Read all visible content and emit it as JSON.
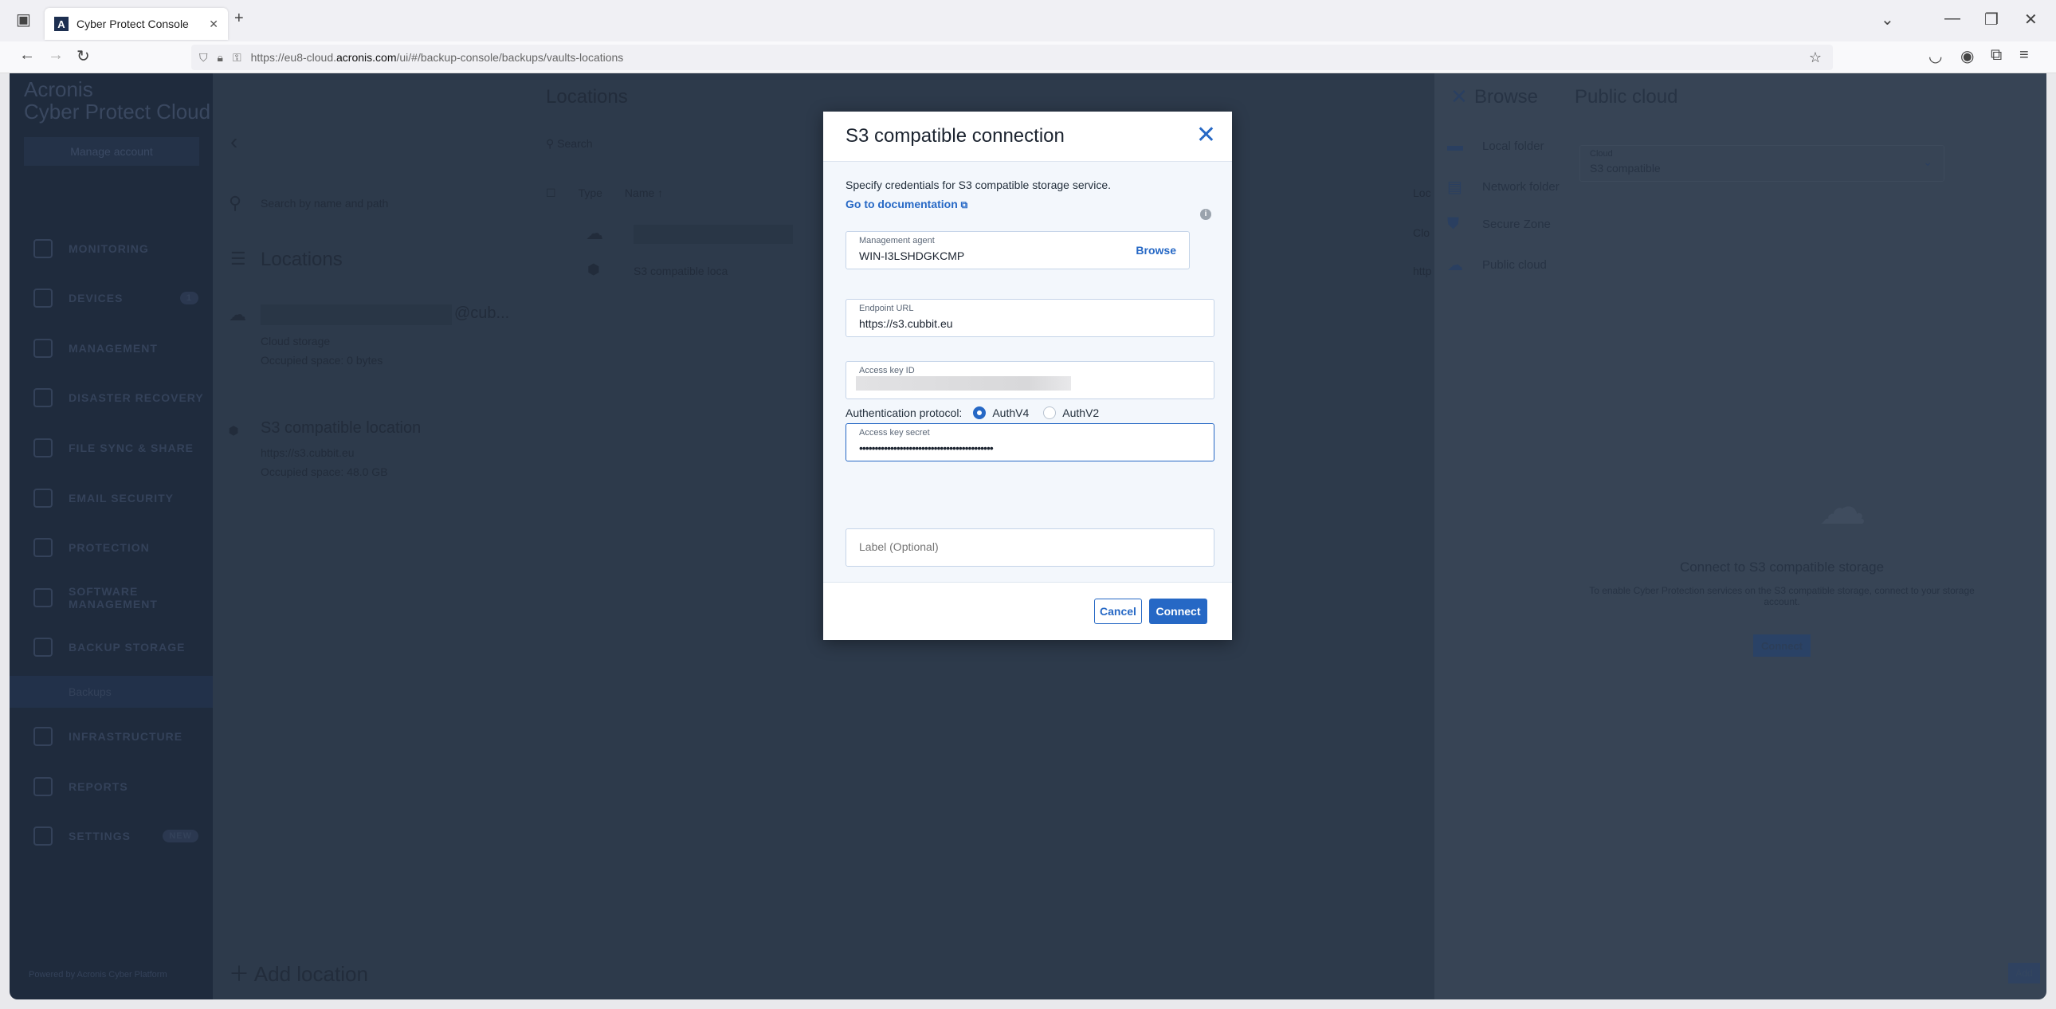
{
  "browser": {
    "tab_title": "Cyber Protect Console",
    "url_prefix": "https://eu8-cloud.",
    "url_domain": "acronis.com",
    "url_path": "/ui/#/backup-console/backups/vaults-locations",
    "favicon": "A"
  },
  "sidebar": {
    "brand_line1": "Acronis",
    "brand_line2": "Cyber Protect Cloud",
    "manage_account": "Manage account",
    "items": [
      {
        "label": "MONITORING"
      },
      {
        "label": "DEVICES",
        "badge": "1"
      },
      {
        "label": "MANAGEMENT"
      },
      {
        "label": "DISASTER RECOVERY"
      },
      {
        "label": "FILE SYNC & SHARE"
      },
      {
        "label": "EMAIL SECURITY"
      },
      {
        "label": "PROTECTION"
      },
      {
        "label": "SOFTWARE MANAGEMENT"
      },
      {
        "label": "BACKUP STORAGE"
      },
      {
        "label": "Backups"
      },
      {
        "label": "INFRASTRUCTURE"
      },
      {
        "label": "REPORTS"
      },
      {
        "label": "SETTINGS",
        "badge": "NEW"
      }
    ],
    "footer": "Powered by Acronis Cyber Platform"
  },
  "locations_panel": {
    "search_placeholder": "Search by name and path",
    "heading": "Locations",
    "items": [
      {
        "name": "@cub...",
        "type": "Cloud storage",
        "space": "Occupied space: 0 bytes"
      },
      {
        "name": "S3 compatible location",
        "type": "https://s3.cubbit.eu",
        "space": "Occupied space: 48.0 GB"
      }
    ],
    "add": "Add location"
  },
  "list": {
    "title": "Locations",
    "search_placeholder": "Search",
    "columns": [
      "Type",
      "Name ↑",
      "Loc"
    ],
    "rows": [
      {
        "name": "",
        "col3": "Clo"
      },
      {
        "name": "S3 compatible loca",
        "col3": "http"
      }
    ]
  },
  "browse": {
    "title": "Browse",
    "items": [
      "Local folder",
      "Network folder",
      "Secure Zone",
      "Public cloud"
    ],
    "public_cloud": {
      "title": "Public cloud",
      "cloud_label": "Cloud",
      "cloud_value": "S3 compatible",
      "empty_title": "Connect to S3 compatible storage",
      "empty_text": "To enable Cyber Protection services on the S3 compatible storage, connect to your storage account.",
      "connect": "Connect",
      "add": "Add"
    }
  },
  "modal": {
    "title": "S3 compatible connection",
    "description": "Specify credentials for S3 compatible storage service.",
    "doc_link": "Go to documentation",
    "agent": {
      "label": "Management agent",
      "value": "WIN-I3LSHDGKCMP",
      "browse": "Browse"
    },
    "endpoint": {
      "label": "Endpoint URL",
      "value": "https://s3.cubbit.eu"
    },
    "key_id": {
      "label": "Access key ID"
    },
    "secret": {
      "label": "Access key secret",
      "value": "•••••••••••••••••••••••••••••••••••••••••••"
    },
    "auth": {
      "label": "Authentication protocol:",
      "options": [
        "AuthV4",
        "AuthV2"
      ],
      "selected": "AuthV4"
    },
    "label_field": {
      "placeholder": "Label (Optional)"
    },
    "cancel": "Cancel",
    "connect": "Connect"
  },
  "colors": {
    "accent": "#2668c5",
    "sidebar": "#1f2b3d",
    "overlay_panel": "#2d3a4b"
  }
}
